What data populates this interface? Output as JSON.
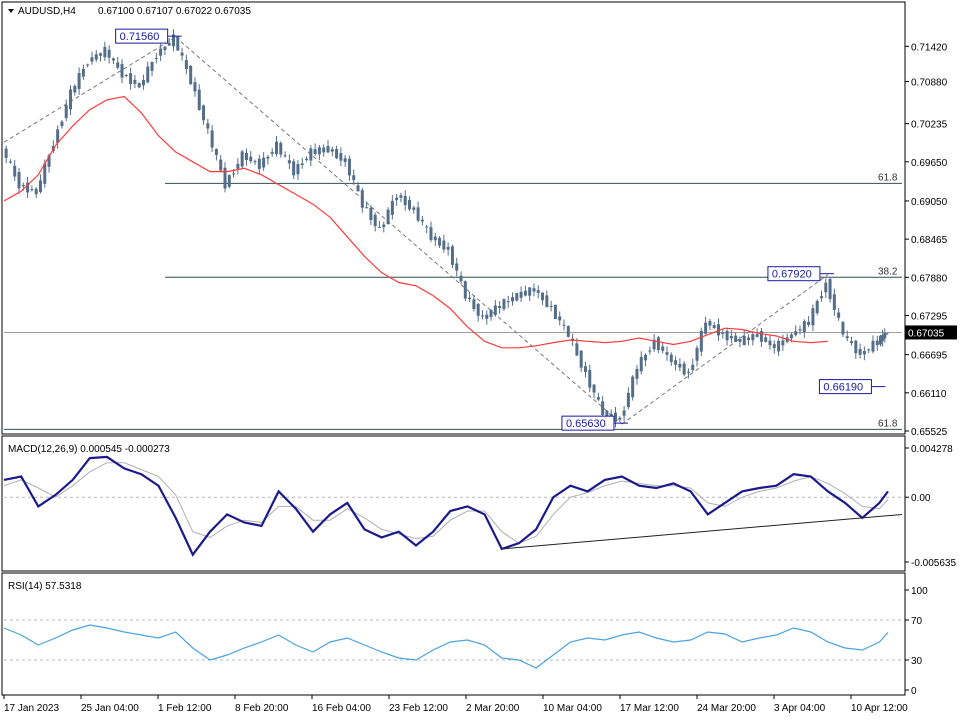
{
  "colors": {
    "candles": "#546e8a",
    "ma": "#ff3b3b",
    "macd_line": "#1a1a8c",
    "macd_signal": "#b0b0b0",
    "rsi": "#4aa3e0",
    "trend": "#777777",
    "hline": "#2f4f4f",
    "grid_dash": "#b8b8b8",
    "swing_box": "#1a1aa0"
  },
  "header": {
    "title": "AUDUSD,H4",
    "quote": "0.67100 0.67107 0.67022 0.67035"
  },
  "chart_data": [
    {
      "type": "line",
      "title": "AUDUSD,H4",
      "ylim": [
        0.65525,
        0.717
      ],
      "y_ticks": [
        "0.71420",
        "0.70880",
        "0.70235",
        "0.69650",
        "0.69050",
        "0.68465",
        "0.67880",
        "0.67295",
        "0.66695",
        "0.66110",
        "0.65525"
      ],
      "current_price": "0.67035",
      "x_ticks": [
        "17 Jan 2023",
        "25 Jan 04:00",
        "1 Feb 12:00",
        "8 Feb 20:00",
        "16 Feb 04:00",
        "23 Feb 12:00",
        "2 Mar 20:00",
        "10 Mar 04:00",
        "17 Mar 12:00",
        "24 Mar 20:00",
        "3 Apr 04:00",
        "10 Apr 12:00"
      ],
      "x": [
        0,
        4,
        8,
        12,
        16,
        20,
        24,
        28,
        32,
        36,
        40,
        44,
        48,
        52,
        56,
        60,
        64,
        68,
        72,
        76,
        80,
        84,
        88,
        92,
        96,
        100,
        104,
        108,
        112,
        116,
        120,
        124,
        128,
        132,
        136,
        140,
        144,
        148,
        152,
        156,
        160,
        164,
        168,
        172,
        176,
        180,
        184,
        188,
        192,
        196,
        200,
        204,
        206
      ],
      "series": [
        {
          "values": [
            0.6985,
            0.693,
            0.6918,
            0.6995,
            0.707,
            0.712,
            0.7135,
            0.71,
            0.708,
            0.713,
            0.7154,
            0.709,
            0.701,
            0.693,
            0.6975,
            0.696,
            0.699,
            0.695,
            0.698,
            0.6985,
            0.6965,
            0.69,
            0.686,
            0.6915,
            0.689,
            0.685,
            0.683,
            0.676,
            0.6725,
            0.6745,
            0.676,
            0.677,
            0.674,
            0.67,
            0.664,
            0.658,
            0.657,
            0.665,
            0.669,
            0.666,
            0.664,
            0.672,
            0.67,
            0.669,
            0.67,
            0.668,
            0.67,
            0.672,
            0.678,
            0.67,
            0.667,
            0.669,
            0.67035
          ]
        },
        {
          "values": [
            0.6905,
            0.692,
            0.6945,
            0.699,
            0.702,
            0.7045,
            0.706,
            0.7065,
            0.704,
            0.7005,
            0.698,
            0.6965,
            0.695,
            0.695,
            0.6955,
            0.6945,
            0.693,
            0.6915,
            0.69,
            0.688,
            0.685,
            0.682,
            0.6795,
            0.678,
            0.6775,
            0.676,
            0.674,
            0.6712,
            0.669,
            0.668,
            0.668,
            0.6683,
            0.6688,
            0.6692,
            0.669,
            0.6688,
            0.669,
            0.6695,
            0.669,
            0.6685,
            0.669,
            0.67,
            0.671,
            0.6708,
            0.6702,
            0.6698,
            0.669,
            0.6688,
            0.669
          ]
        }
      ],
      "fibonacci": [
        {
          "level": "61.8",
          "value": 0.6932
        },
        {
          "level": "38.2",
          "value": 0.6788
        },
        {
          "level": "61.8",
          "value": 0.6555
        }
      ],
      "swing_labels": [
        {
          "label": "0.71560",
          "value": 0.7156
        },
        {
          "label": "0.65630",
          "value": 0.6563
        },
        {
          "label": "0.67920",
          "value": 0.6792
        },
        {
          "label": "0.66190",
          "value": 0.6619
        }
      ]
    },
    {
      "type": "line",
      "title": "MACD(12,26,9) 0.000545 -0.000273",
      "ylim": [
        -0.005635,
        0.004278
      ],
      "y_ticks": [
        "0.004278",
        "0.00",
        "-0.005635"
      ],
      "series": [
        {
          "values": [
            0.0015,
            0.0018,
            -0.0008,
            0.0002,
            0.0015,
            0.0034,
            0.0035,
            0.0025,
            0.002,
            0.001,
            -0.0018,
            -0.005,
            -0.003,
            -0.0015,
            -0.0022,
            -0.0025,
            0.0005,
            -0.001,
            -0.003,
            -0.0015,
            -0.0005,
            -0.0028,
            -0.0035,
            -0.003,
            -0.0042,
            -0.003,
            -0.0012,
            -0.0008,
            -0.0015,
            -0.0045,
            -0.004,
            -0.0028,
            0.0,
            0.001,
            0.0005,
            0.0015,
            0.0018,
            0.001,
            0.0008,
            0.0012,
            0.0005,
            -0.0015,
            -0.0005,
            0.0005,
            0.0008,
            0.001,
            0.002,
            0.0018,
            0.0005,
            -0.0005,
            -0.0018,
            -0.0005,
            0.0005
          ]
        },
        {
          "values": [
            0.001,
            0.0015,
            0.0008,
            0.0,
            0.001,
            0.0022,
            0.003,
            0.003,
            0.0024,
            0.0018,
            0.0002,
            -0.003,
            -0.0035,
            -0.0025,
            -0.002,
            -0.0022,
            -0.0008,
            -0.0008,
            -0.002,
            -0.002,
            -0.001,
            -0.0018,
            -0.0028,
            -0.0032,
            -0.0036,
            -0.0034,
            -0.002,
            -0.0012,
            -0.0012,
            -0.003,
            -0.004,
            -0.0034,
            -0.0015,
            0.0,
            0.0004,
            0.001,
            0.0014,
            0.0012,
            0.001,
            0.001,
            0.0008,
            -0.0005,
            -0.0008,
            0.0,
            0.0005,
            0.0008,
            0.0014,
            0.0018,
            0.0012,
            0.0003,
            -0.0008,
            -0.001,
            -0.0002
          ]
        }
      ]
    },
    {
      "type": "line",
      "title": "RSI(14) 57.5318",
      "ylim": [
        0,
        100
      ],
      "y_ticks": [
        "100",
        "70",
        "30",
        "0"
      ],
      "series": [
        {
          "values": [
            62,
            55,
            45,
            52,
            60,
            65,
            62,
            58,
            55,
            52,
            58,
            42,
            30,
            35,
            42,
            48,
            55,
            45,
            38,
            48,
            52,
            45,
            38,
            32,
            30,
            40,
            48,
            50,
            45,
            32,
            30,
            22,
            35,
            48,
            52,
            50,
            55,
            58,
            52,
            48,
            50,
            58,
            56,
            48,
            52,
            55,
            62,
            58,
            48,
            42,
            40,
            48,
            57.5
          ]
        }
      ]
    }
  ]
}
